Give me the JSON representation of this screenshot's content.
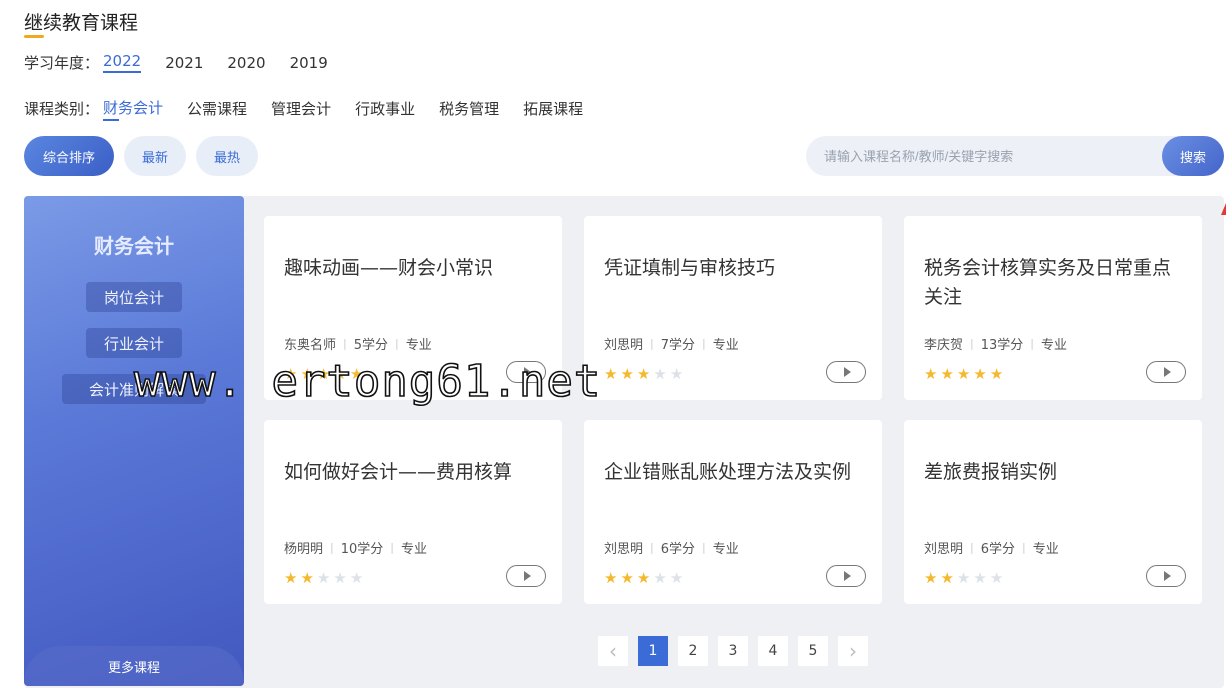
{
  "page": {
    "title": "继续教育课程"
  },
  "year_filter": {
    "label": "学习年度：",
    "options": [
      "2022",
      "2021",
      "2020",
      "2019"
    ],
    "selected": "2022"
  },
  "category_filter": {
    "label": "课程类别：",
    "options": [
      "财务会计",
      "公需课程",
      "管理会计",
      "行政事业",
      "税务管理",
      "拓展课程"
    ],
    "selected": "财务会计"
  },
  "sort": {
    "options": [
      "综合排序",
      "最新",
      "最热"
    ],
    "selected": "综合排序"
  },
  "search": {
    "placeholder": "请输入课程名称/教师/关键字搜索",
    "button_label": "搜索"
  },
  "side_panel": {
    "title": "财务会计",
    "tags": [
      "岗位会计",
      "行业会计",
      "会计准则解读"
    ],
    "more_label": "更多课程"
  },
  "courses": [
    {
      "title": "趣味动画——财会小常识",
      "teacher": "东奥名师",
      "credits": "5学分",
      "type": "专业",
      "rating": 5
    },
    {
      "title": "凭证填制与审核技巧",
      "teacher": "刘思明",
      "credits": "7学分",
      "type": "专业",
      "rating": 3
    },
    {
      "title": "税务会计核算实务及日常重点关注",
      "teacher": "李庆贺",
      "credits": "13学分",
      "type": "专业",
      "rating": 5
    },
    {
      "title": "如何做好会计——费用核算",
      "teacher": "杨明明",
      "credits": "10学分",
      "type": "专业",
      "rating": 2
    },
    {
      "title": "企业错账乱账处理方法及实例",
      "teacher": "刘思明",
      "credits": "6学分",
      "type": "专业",
      "rating": 3
    },
    {
      "title": "差旅费报销实例",
      "teacher": "刘思明",
      "credits": "6学分",
      "type": "专业",
      "rating": 2
    }
  ],
  "pagination": {
    "pages": [
      "1",
      "2",
      "3",
      "4",
      "5"
    ],
    "current": "1",
    "prev_icon": "chevron-left",
    "next_icon": "chevron-right"
  },
  "watermark": {
    "text": "www. ertong61.net"
  },
  "colors": {
    "accent": "#3a6bd6",
    "title_underline": "#f0a820",
    "star_on": "#f5b82e",
    "star_off": "#dde1e8"
  }
}
